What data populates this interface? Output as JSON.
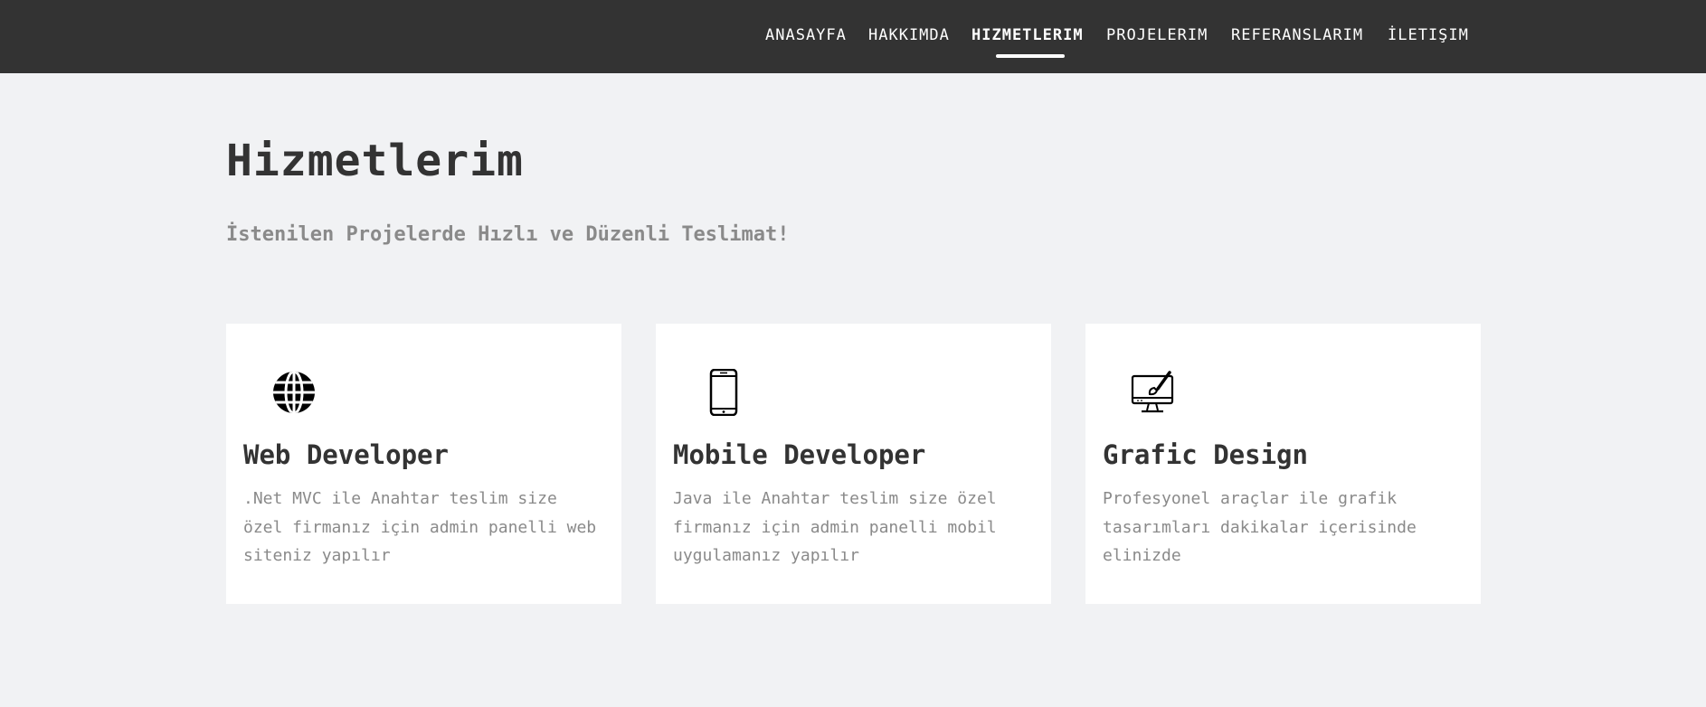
{
  "nav": {
    "items": [
      {
        "label": "ANASAYFA",
        "active": false
      },
      {
        "label": "HAKKIMDA",
        "active": false
      },
      {
        "label": "HIZMETLERIM",
        "active": true
      },
      {
        "label": "PROJELERIM",
        "active": false
      },
      {
        "label": "REFERANSLARIM",
        "active": false
      },
      {
        "label": "İLETIŞIM",
        "active": false
      }
    ]
  },
  "section": {
    "title": "Hizmetlerim",
    "subtitle": "İstenilen Projelerde Hızlı ve Düzenli Teslimat!"
  },
  "services": [
    {
      "icon": "globe-icon",
      "title": "Web Developer",
      "description": ".Net MVC ile Anahtar teslim size özel firmanız için admin panelli web siteniz yapılır"
    },
    {
      "icon": "smartphone-icon",
      "title": "Mobile Developer",
      "description": "Java ile Anahtar teslim size özel firmanız için admin panelli mobil uygulamanız yapılır"
    },
    {
      "icon": "monitor-brush-icon",
      "title": "Grafic Design",
      "description": "Profesyonel araçlar ile grafik tasarımları dakikalar içerisinde elinizde"
    }
  ],
  "colors": {
    "topbar": "#333333",
    "background": "#f1f2f4",
    "card": "#ffffff",
    "heading": "#333333",
    "muted": "#8a8a8a"
  }
}
